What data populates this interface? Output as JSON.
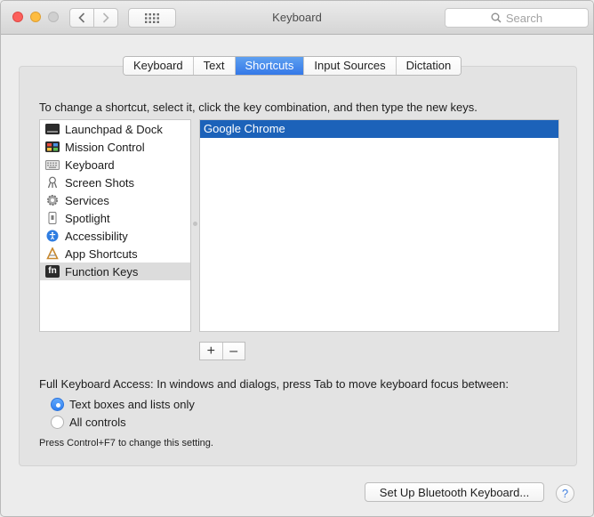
{
  "window": {
    "title": "Keyboard"
  },
  "search": {
    "placeholder": "Search"
  },
  "tabs": [
    {
      "label": "Keyboard"
    },
    {
      "label": "Text"
    },
    {
      "label": "Shortcuts",
      "active": true
    },
    {
      "label": "Input Sources"
    },
    {
      "label": "Dictation"
    }
  ],
  "instruction": "To change a shortcut, select it, click the key combination, and then type the new keys.",
  "categories": [
    {
      "label": "Launchpad & Dock",
      "icon": "launchpad-icon"
    },
    {
      "label": "Mission Control",
      "icon": "mission-control-icon"
    },
    {
      "label": "Keyboard",
      "icon": "keyboard-icon"
    },
    {
      "label": "Screen Shots",
      "icon": "screenshot-icon"
    },
    {
      "label": "Services",
      "icon": "gear-icon"
    },
    {
      "label": "Spotlight",
      "icon": "spotlight-icon"
    },
    {
      "label": "Accessibility",
      "icon": "accessibility-icon"
    },
    {
      "label": "App Shortcuts",
      "icon": "app-shortcuts-icon"
    },
    {
      "label": "Function Keys",
      "icon": "fn-icon",
      "selected": true,
      "icon_text": "fn"
    }
  ],
  "apps": [
    {
      "label": "Google Chrome",
      "selected": true
    }
  ],
  "list_controls": {
    "add": "+",
    "remove": "–"
  },
  "full_keyboard_access": {
    "label": "Full Keyboard Access: In windows and dialogs, press Tab to move keyboard focus between:",
    "options": [
      {
        "label": "Text boxes and lists only",
        "checked": true
      },
      {
        "label": "All controls",
        "checked": false
      }
    ],
    "note": "Press Control+F7 to change this setting."
  },
  "footer": {
    "bluetooth_button": "Set Up Bluetooth Keyboard...",
    "help": "?"
  },
  "colors": {
    "accent": "#3478e8",
    "selection": "#1c62b9"
  }
}
